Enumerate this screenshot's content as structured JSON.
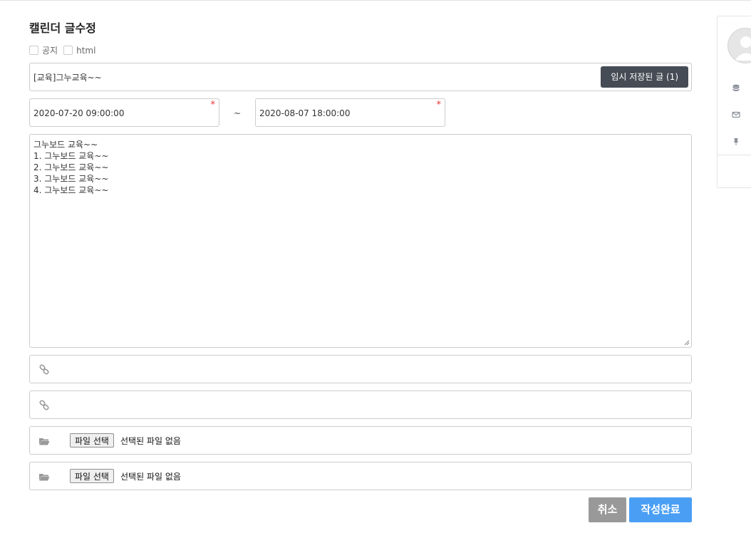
{
  "page": {
    "title": "캘린더 글수정"
  },
  "options": {
    "notice_label": "공지",
    "html_label": "html"
  },
  "subject": {
    "value": "[교육]그누교육~~",
    "draft_button": "임시 저장된 글 (1)"
  },
  "dates": {
    "start": "2020-07-20 09:00:00",
    "end": "2020-08-07 18:00:00",
    "separator": "~",
    "required_mark": "*"
  },
  "content": {
    "text": "그누보드 교육~~\n1. 그누보드 교육~~\n2. 그누보드 교육~~\n3. 그누보드 교육~~\n4. 그누보드 교육~~"
  },
  "files": [
    {
      "button": "파일 선택",
      "status": "선택된 파일 없음"
    },
    {
      "button": "파일 선택",
      "status": "선택된 파일 없음"
    }
  ],
  "actions": {
    "cancel": "취소",
    "submit": "작성완료"
  },
  "icons": {
    "link": "link-icon",
    "folder": "folder-open-icon",
    "database": "database-icon",
    "envelope": "envelope-icon",
    "pin": "thumbtack-icon"
  },
  "colors": {
    "submit": "#4a9ff5",
    "cancel": "#999999",
    "draft": "#454c55",
    "required": "#ee3333"
  }
}
